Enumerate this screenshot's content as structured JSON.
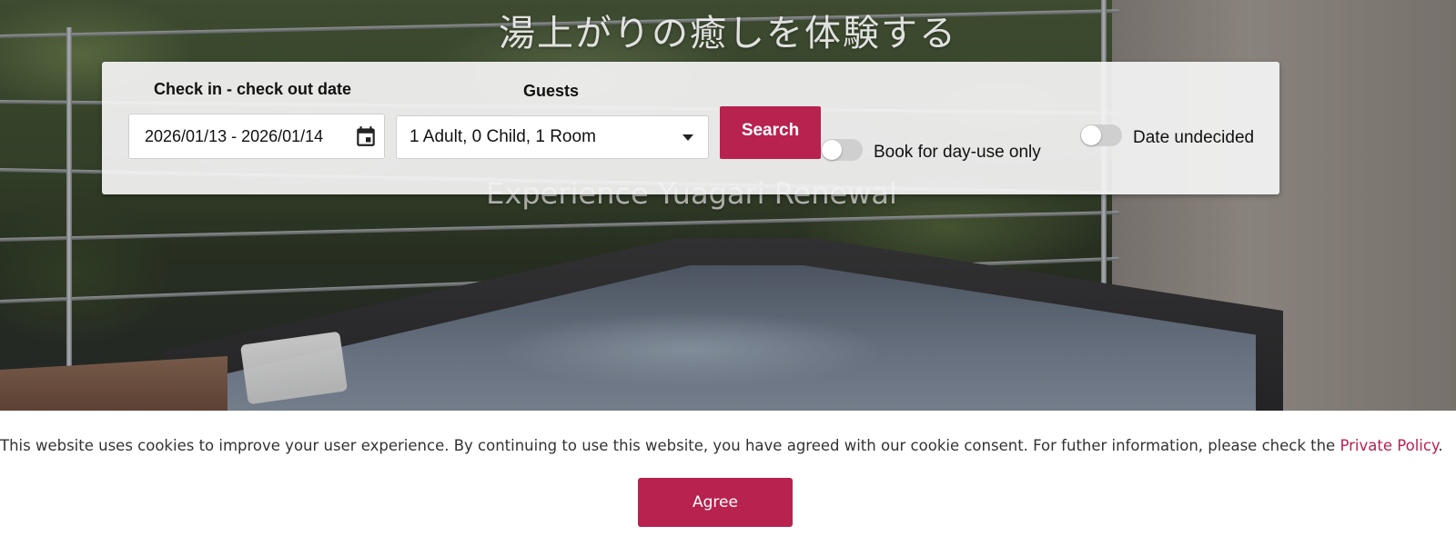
{
  "hero": {
    "title_jp": "湯上がりの癒しを体験する",
    "title_en": "Experience Yuagari Renewal"
  },
  "booking": {
    "dates_label": "Check in - check out date",
    "dates_value": "2026/01/13 - 2026/01/14",
    "calendar_icon": "calendar-icon",
    "guests_label": "Guests",
    "guests_value": "1 Adult, 0 Child, 1 Room",
    "search_label": "Search",
    "day_use_label": "Book for day-use only",
    "day_use_on": false,
    "date_undecided_label": "Date undecided",
    "date_undecided_on": false
  },
  "cookie": {
    "message": "This website uses cookies to improve your user experience. By continuing to use this website, you have agreed with our cookie consent. For futher information, please check the ",
    "link_text": "Private Policy",
    "suffix": ".",
    "agree_label": "Agree"
  },
  "colors": {
    "accent": "#b8224f",
    "panel": "#f4f4f4",
    "toggle_off": "#cfcfcf"
  }
}
